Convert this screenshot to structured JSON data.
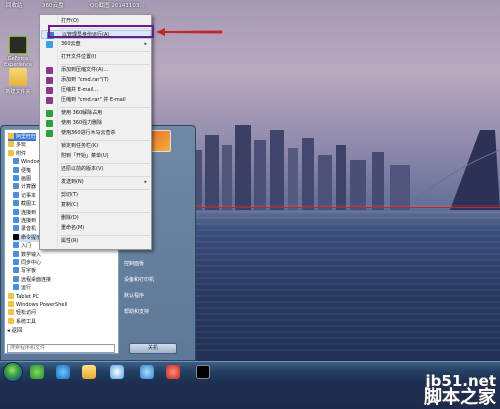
{
  "desktop": {
    "top_labels": [
      "回收站",
      "360云盘",
      "QQ截图\n20141103..."
    ],
    "icons": [
      {
        "label": "GeForce\nExperience",
        "icon": "geforce-icon"
      },
      {
        "label": "新建文件夹",
        "icon": "folder-icon"
      }
    ]
  },
  "context_menu": {
    "items": [
      {
        "label": "打开(O)",
        "icon": ""
      },
      {
        "label": "以管理员身份运行(A)",
        "icon": "shield-icon",
        "highlighted": true
      },
      {
        "label": "360云盘",
        "icon": "cloud-icon",
        "submenu": true
      },
      {
        "label": "打开文件位置(I)",
        "icon": ""
      },
      {
        "label": "添加到压缩文件(A)...",
        "icon": "archive-icon"
      },
      {
        "label": "添加到 \"cmd.rar\"(T)",
        "icon": "archive-icon"
      },
      {
        "label": "压缩并 E-mail...",
        "icon": "archive-icon"
      },
      {
        "label": "压缩到 \"cmd.rar\" 并 E-mail",
        "icon": "archive-icon"
      },
      {
        "label": "使用 360解除占用",
        "icon": "shield-360-icon"
      },
      {
        "label": "使用 360强力删除",
        "icon": "shield-360-icon"
      },
      {
        "label": "使用360进行木马云查杀",
        "icon": "shield-360-icon"
      },
      {
        "label": "锁定到任务栏(K)",
        "icon": ""
      },
      {
        "label": "附到「开始」菜单(U)",
        "icon": ""
      },
      {
        "label": "还原以前的版本(V)",
        "icon": ""
      },
      {
        "label": "发送到(N)",
        "icon": "",
        "submenu": true
      },
      {
        "label": "剪切(T)",
        "icon": ""
      },
      {
        "label": "复制(C)",
        "icon": ""
      },
      {
        "label": "删除(D)",
        "icon": ""
      },
      {
        "label": "重命名(M)",
        "icon": ""
      },
      {
        "label": "属性(R)",
        "icon": ""
      }
    ]
  },
  "start_menu": {
    "programs": [
      {
        "label": "阿里旺旺",
        "icon": "folder-icon",
        "selected": true
      },
      {
        "label": "多玩",
        "icon": "folder-icon"
      },
      {
        "label": "附件",
        "icon": "folder-icon"
      },
      {
        "label": "Windows",
        "icon": "app-icon"
      },
      {
        "label": "便笺",
        "icon": "app-icon"
      },
      {
        "label": "画图",
        "icon": "app-icon"
      },
      {
        "label": "计算器",
        "icon": "app-icon"
      },
      {
        "label": "记事本",
        "icon": "app-icon"
      },
      {
        "label": "截图工",
        "icon": "app-icon"
      },
      {
        "label": "连接到",
        "icon": "app-icon"
      },
      {
        "label": "连接到",
        "icon": "app-icon"
      },
      {
        "label": "录音机",
        "icon": "app-icon"
      },
      {
        "label": "命令提示",
        "icon": "cmd-icon",
        "active": true
      },
      {
        "label": "入门",
        "icon": "app-icon"
      },
      {
        "label": "数学输入",
        "icon": "app-icon"
      },
      {
        "label": "同步中心",
        "icon": "app-icon"
      },
      {
        "label": "写字板",
        "icon": "app-icon"
      },
      {
        "label": "远程桌面连接",
        "icon": "app-icon"
      },
      {
        "label": "运行",
        "icon": "app-icon"
      },
      {
        "label": "Tablet PC",
        "icon": "folder-icon"
      },
      {
        "label": "Windows PowerShell",
        "icon": "folder-icon"
      },
      {
        "label": "轻松访问",
        "icon": "folder-icon"
      },
      {
        "label": "系统工具",
        "icon": "folder-icon"
      }
    ],
    "back_label": "返回",
    "search_placeholder": "搜索程序和文件",
    "right_items": [
      "控制面板",
      "设备和打印机",
      "默认程序",
      "帮助和支持"
    ],
    "shutdown_label": "关机"
  },
  "watermark": {
    "top": "jb51.net",
    "bottom": "脚本之家"
  }
}
